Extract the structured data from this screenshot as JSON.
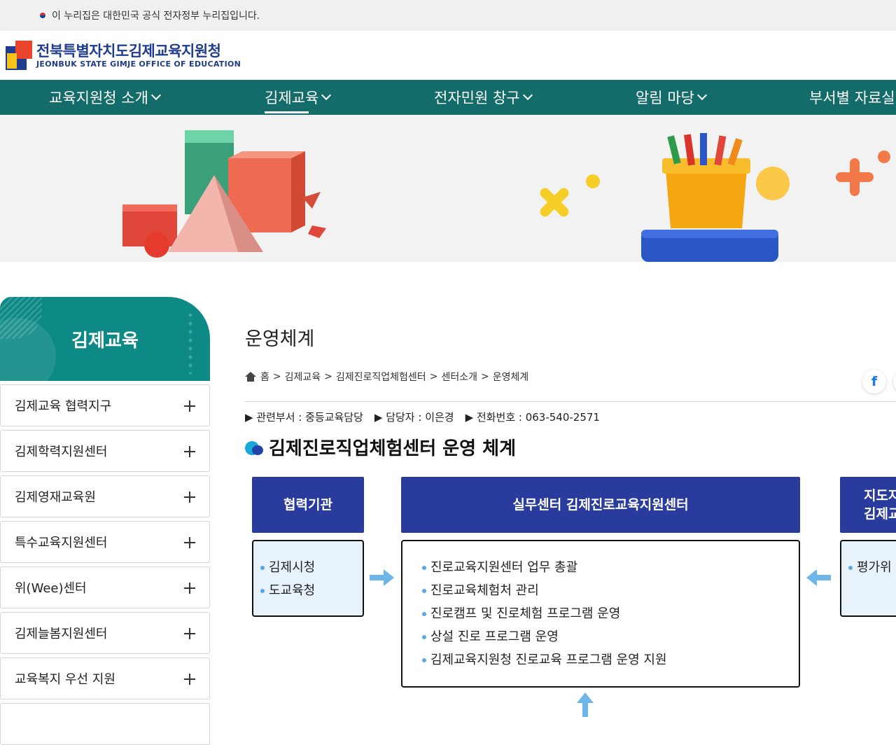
{
  "gov_banner": {
    "text": "이 누리집은 대한민국 공식 전자정부 누리집입니다."
  },
  "logo": {
    "name_ko": "전북특별자치도김제교육지원청",
    "name_en": "JEONBUK STATE GIMJE OFFICE OF EDUCATION"
  },
  "gnb": [
    {
      "label": "교육지원청 소개",
      "active": false
    },
    {
      "label": "김제교육",
      "active": true
    },
    {
      "label": "전자민원 창구",
      "active": false
    },
    {
      "label": "알림 마당",
      "active": false
    },
    {
      "label": "부서별 자료실",
      "active": false
    }
  ],
  "sidebar": {
    "title": "김제교육",
    "items": [
      {
        "label": "김제교육 협력지구"
      },
      {
        "label": "김제학력지원센터"
      },
      {
        "label": "김제영재교육원"
      },
      {
        "label": "특수교육지원센터"
      },
      {
        "label": "위(Wee)센터"
      },
      {
        "label": "김제늘봄지원센터"
      },
      {
        "label": "교육복지 우선 지원"
      }
    ]
  },
  "page": {
    "title": "운영체계",
    "breadcrumb": [
      "홈",
      ">",
      "김제교육",
      ">",
      "김제진로직업체험센터",
      ">",
      "센터소개",
      ">",
      "운영체계"
    ],
    "meta": {
      "dept": "▶ 관련부서 :  중등교육담당",
      "person": "▶ 담당자 : 이은경",
      "phone": "▶ 전화번호 : 063-540-2571"
    },
    "section_title": "김제진로직업체험센터 운영 체계"
  },
  "org_chart": {
    "left": {
      "title": "협력기관",
      "items": [
        "김제시청",
        "도교육청"
      ]
    },
    "center": {
      "title": "실무센터 김제진로교육지원센터",
      "items": [
        "진로교육지원센터 업무 총괄",
        "진로교육체험처 관리",
        "진로캠프 및 진로체험 프로그램 운영",
        "상설 진로 프로그램 운영",
        "김제교육지원청 진로교육 프로그램 운영 지원"
      ]
    },
    "right": {
      "title_line1": "지도자",
      "title_line2": "김제교",
      "items": [
        "평가위"
      ]
    }
  },
  "social": {
    "facebook_icon": "facebook-icon"
  },
  "colors": {
    "gnb": "#136c6a",
    "side_head": "#0e8a86",
    "org_head": "#2a3b9e",
    "brand": "#1f3c8f"
  }
}
